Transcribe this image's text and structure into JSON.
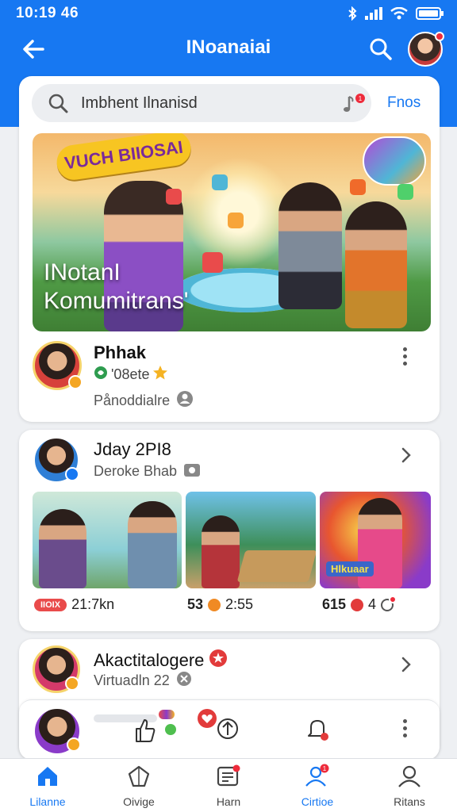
{
  "status": {
    "time": "10:19 46"
  },
  "appbar": {
    "title": "INoanaiai"
  },
  "search": {
    "value": "Imbhent Ilnanisd",
    "filter_label": "Fnos"
  },
  "hero": {
    "banner": "VUCH BIIOSAI",
    "overlay_line1": "INotanI",
    "overlay_line2": "Komumitrans'"
  },
  "post1": {
    "name": "Phhak",
    "meta": "'08ete",
    "subtitle": "Pånoddialre"
  },
  "post2": {
    "name": "Jday 2PI8",
    "subtitle": "Deroke Bhab",
    "thumbs": [
      {
        "badge": "IIOIX",
        "stat": "21:7kn"
      },
      {
        "stat_a": "53",
        "stat_b": "2:55"
      },
      {
        "label": "Hlkuaar",
        "stat_a": "615",
        "stat_b": "4"
      }
    ]
  },
  "post3": {
    "name": "Akactitalogere",
    "subtitle": "Virtuadln 22"
  },
  "nav": [
    {
      "label": "Lilanne"
    },
    {
      "label": "Oivige"
    },
    {
      "label": "Harn"
    },
    {
      "label": "Cirtioe"
    },
    {
      "label": "Ritans"
    }
  ],
  "colors": {
    "primary": "#1778f2",
    "notification": "#ee2b3b",
    "accent_gold": "#f4a623"
  }
}
